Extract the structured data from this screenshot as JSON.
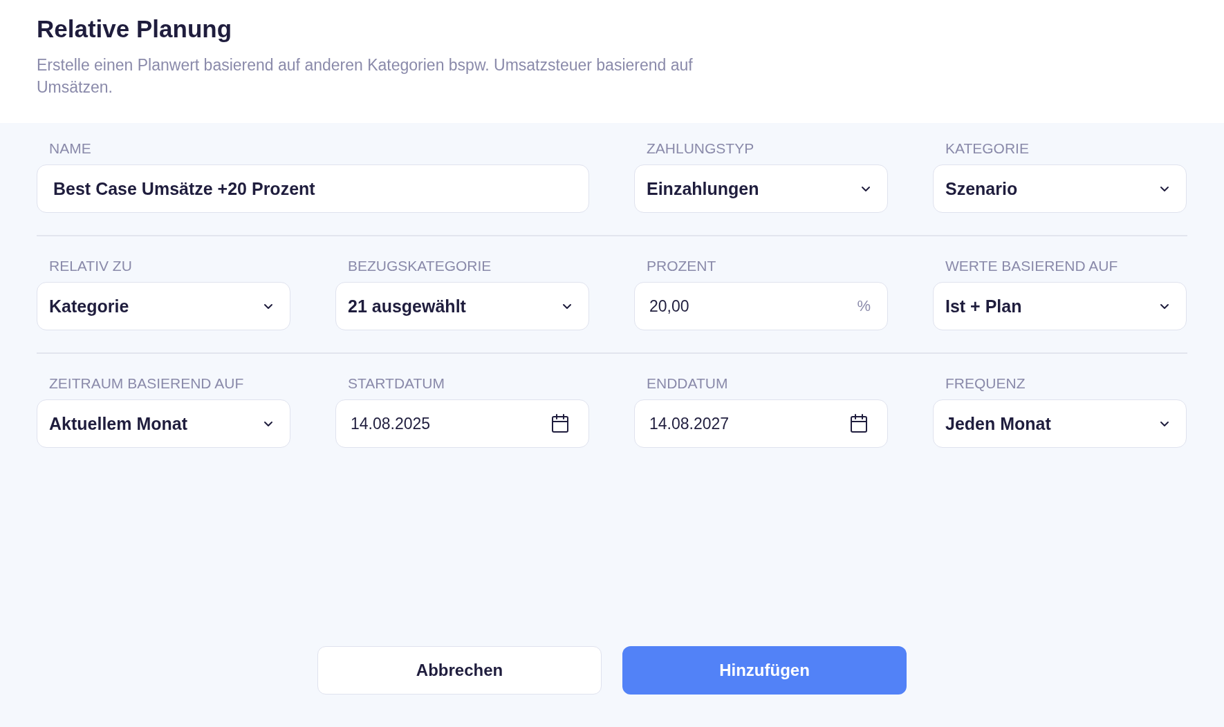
{
  "header": {
    "title": "Relative Planung",
    "description": "Erstelle einen Planwert basierend auf anderen Kategorien bspw. Umsatzsteuer basierend auf Umsätzen."
  },
  "rows": [
    [
      {
        "label": "NAME",
        "kind": "text",
        "value": "Best Case Umsätze +20 Prozent"
      },
      {
        "label": "ZAHLUNGSTYP",
        "kind": "select",
        "value": "Einzahlungen"
      },
      {
        "label": "KATEGORIE",
        "kind": "select",
        "value": "Szenario"
      }
    ],
    [
      {
        "label": "RELATIV ZU",
        "kind": "select",
        "value": "Kategorie"
      },
      {
        "label": "BEZUGSKATEGORIE",
        "kind": "select",
        "value": "21 ausgewählt"
      },
      {
        "label": "PROZENT",
        "kind": "percent",
        "value": "20,00",
        "suffix": "%"
      },
      {
        "label": "WERTE BASIEREND AUF",
        "kind": "select",
        "value": "Ist + Plan"
      }
    ],
    [
      {
        "label": "ZEITRAUM BASIEREND AUF",
        "kind": "select",
        "value": "Aktuellem Monat"
      },
      {
        "label": "STARTDATUM",
        "kind": "date",
        "value": "14.08.2025"
      },
      {
        "label": "ENDDATUM",
        "kind": "date",
        "value": "14.08.2027"
      },
      {
        "label": "FREQUENZ",
        "kind": "select",
        "value": "Jeden Monat"
      }
    ]
  ],
  "buttons": [
    {
      "label": "Abbrechen",
      "kind": "secondary"
    },
    {
      "label": "Hinzufügen",
      "kind": "primary"
    }
  ]
}
